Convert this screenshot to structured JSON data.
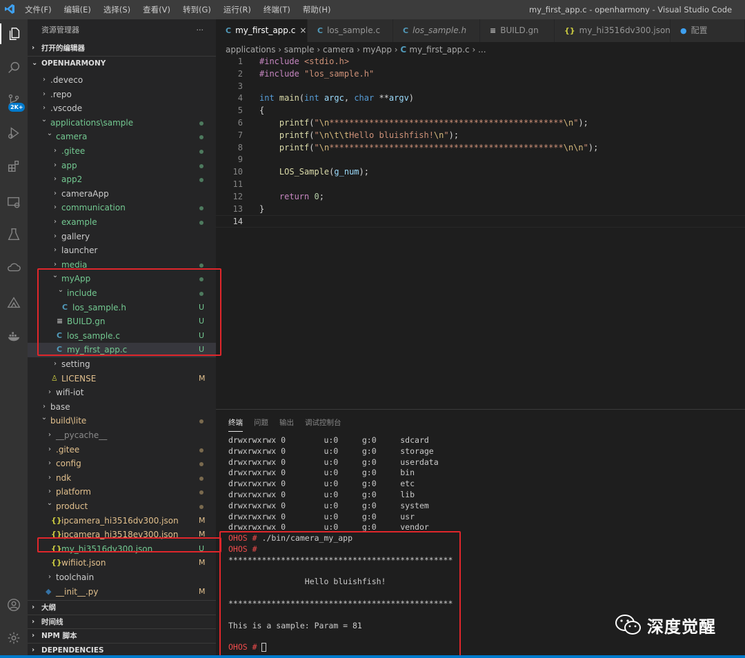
{
  "titlebar": {
    "menu": [
      "文件(F)",
      "编辑(E)",
      "选择(S)",
      "查看(V)",
      "转到(G)",
      "运行(R)",
      "终端(T)",
      "帮助(H)"
    ],
    "window_title": "my_first_app.c - openharmony - Visual Studio Code"
  },
  "activity": {
    "badge": "2K+"
  },
  "sidebar": {
    "header": "资源管理器",
    "more": "···",
    "open_editors": "打开的编辑器",
    "workspace": "OPENHARMONY",
    "items": [
      {
        "label": ".deveco",
        "depth": 0,
        "type": "folder",
        "status": ""
      },
      {
        "label": ".repo",
        "depth": 0,
        "type": "folder",
        "status": ""
      },
      {
        "label": ".vscode",
        "depth": 0,
        "type": "folder",
        "status": ""
      },
      {
        "label": "applications\\sample",
        "depth": 0,
        "type": "folder-open",
        "status": "dot",
        "color": "#73c991"
      },
      {
        "label": "camera",
        "depth": 1,
        "type": "folder-open",
        "status": "dot",
        "color": "#73c991"
      },
      {
        "label": ".gitee",
        "depth": 2,
        "type": "folder",
        "status": "dot",
        "color": "#73c991"
      },
      {
        "label": "app",
        "depth": 2,
        "type": "folder",
        "status": "dot",
        "color": "#73c991"
      },
      {
        "label": "app2",
        "depth": 2,
        "type": "folder",
        "status": "dot",
        "color": "#73c991"
      },
      {
        "label": "cameraApp",
        "depth": 2,
        "type": "folder",
        "status": ""
      },
      {
        "label": "communication",
        "depth": 2,
        "type": "folder",
        "status": "dot",
        "color": "#73c991"
      },
      {
        "label": "example",
        "depth": 2,
        "type": "folder",
        "status": "dot",
        "color": "#73c991"
      },
      {
        "label": "gallery",
        "depth": 2,
        "type": "folder",
        "status": ""
      },
      {
        "label": "launcher",
        "depth": 2,
        "type": "folder",
        "status": ""
      },
      {
        "label": "media",
        "depth": 2,
        "type": "folder",
        "status": "dot",
        "color": "#73c991"
      },
      {
        "label": "myApp",
        "depth": 2,
        "type": "folder-open",
        "status": "dot",
        "color": "#73c991"
      },
      {
        "label": "include",
        "depth": 3,
        "type": "folder-open",
        "status": "dot",
        "color": "#73c991"
      },
      {
        "label": "los_sample.h",
        "depth": 4,
        "type": "c",
        "status": "U",
        "color": "#73c991"
      },
      {
        "label": "BUILD.gn",
        "depth": 3,
        "type": "gn",
        "status": "U",
        "color": "#73c991"
      },
      {
        "label": "los_sample.c",
        "depth": 3,
        "type": "c",
        "status": "U",
        "color": "#73c991"
      },
      {
        "label": "my_first_app.c",
        "depth": 3,
        "type": "c",
        "status": "U",
        "color": "#73c991",
        "selected": true
      },
      {
        "label": "setting",
        "depth": 2,
        "type": "folder",
        "status": ""
      },
      {
        "label": "LICENSE",
        "depth": 2,
        "type": "license",
        "status": "M",
        "color": "#e2c08d"
      },
      {
        "label": "wifi-iot",
        "depth": 1,
        "type": "folder",
        "status": ""
      },
      {
        "label": "base",
        "depth": 0,
        "type": "folder",
        "status": ""
      },
      {
        "label": "build\\lite",
        "depth": 0,
        "type": "folder-open",
        "status": "dot",
        "color": "#e2c08d"
      },
      {
        "label": "__pycache__",
        "depth": 1,
        "type": "folder",
        "status": "",
        "color": "#8c8c8c"
      },
      {
        "label": ".gitee",
        "depth": 1,
        "type": "folder",
        "status": "dot",
        "color": "#e2c08d"
      },
      {
        "label": "config",
        "depth": 1,
        "type": "folder",
        "status": "dot",
        "color": "#e2c08d"
      },
      {
        "label": "ndk",
        "depth": 1,
        "type": "folder",
        "status": "dot",
        "color": "#e2c08d"
      },
      {
        "label": "platform",
        "depth": 1,
        "type": "folder",
        "status": "dot",
        "color": "#e2c08d"
      },
      {
        "label": "product",
        "depth": 1,
        "type": "folder-open",
        "status": "dot",
        "color": "#e2c08d"
      },
      {
        "label": "ipcamera_hi3516dv300.json",
        "depth": 2,
        "type": "json",
        "status": "M",
        "color": "#e2c08d"
      },
      {
        "label": "ipcamera_hi3518ev300.json",
        "depth": 2,
        "type": "json",
        "status": "M",
        "color": "#e2c08d"
      },
      {
        "label": "my_hi3516dv300.json",
        "depth": 2,
        "type": "json",
        "status": "U",
        "color": "#73c991"
      },
      {
        "label": "wifiiot.json",
        "depth": 2,
        "type": "json",
        "status": "M",
        "color": "#e2c08d"
      },
      {
        "label": "toolchain",
        "depth": 1,
        "type": "folder",
        "status": ""
      },
      {
        "label": "__init__.py",
        "depth": 1,
        "type": "py",
        "status": "M",
        "color": "#e2c08d"
      }
    ],
    "sections": [
      "大纲",
      "时间线",
      "NPM 脚本",
      "DEPENDENCIES"
    ]
  },
  "tabs": [
    {
      "label": "my_first_app.c",
      "icon": "C",
      "active": true,
      "close": "×"
    },
    {
      "label": "los_sample.c",
      "icon": "C"
    },
    {
      "label": "los_sample.h",
      "icon": "C",
      "italic": true
    },
    {
      "label": "BUILD.gn",
      "icon": "≡"
    },
    {
      "label": "my_hi3516dv300.json",
      "icon": "{}"
    },
    {
      "label": "配置",
      "icon": "●"
    }
  ],
  "breadcrumb": {
    "parts": [
      "applications",
      "sample",
      "camera",
      "myApp"
    ],
    "file": "my_first_app.c",
    "tail": "..."
  },
  "code": [
    {
      "n": "1",
      "t": [
        [
          "#include ",
          "#c586c0"
        ],
        [
          "<stdio.h>",
          "#ce9178"
        ]
      ]
    },
    {
      "n": "2",
      "t": [
        [
          "#include ",
          "#c586c0"
        ],
        [
          "\"los_sample.h\"",
          "#ce9178"
        ]
      ]
    },
    {
      "n": "3",
      "t": []
    },
    {
      "n": "4",
      "t": [
        [
          "int ",
          "#569cd6"
        ],
        [
          "main",
          "#dcdcaa"
        ],
        [
          "(",
          "#d4d4d4"
        ],
        [
          "int ",
          "#569cd6"
        ],
        [
          "argc",
          "#9cdcfe"
        ],
        [
          ", ",
          "#d4d4d4"
        ],
        [
          "char ",
          "#569cd6"
        ],
        [
          "**",
          "#d4d4d4"
        ],
        [
          "argv",
          "#9cdcfe"
        ],
        [
          ")",
          "#d4d4d4"
        ]
      ]
    },
    {
      "n": "5",
      "t": [
        [
          "{",
          "#d4d4d4"
        ]
      ]
    },
    {
      "n": "6",
      "t": [
        [
          "    ",
          ""
        ],
        [
          "printf",
          "#dcdcaa"
        ],
        [
          "(",
          "#d4d4d4"
        ],
        [
          "\"",
          "#ce9178"
        ],
        [
          "\\n",
          "#d7ba7d"
        ],
        [
          "***********************************************",
          "#ce9178"
        ],
        [
          "\\n",
          "#d7ba7d"
        ],
        [
          "\"",
          "#ce9178"
        ],
        [
          ");",
          "#d4d4d4"
        ]
      ]
    },
    {
      "n": "7",
      "t": [
        [
          "    ",
          ""
        ],
        [
          "printf",
          "#dcdcaa"
        ],
        [
          "(",
          "#d4d4d4"
        ],
        [
          "\"",
          "#ce9178"
        ],
        [
          "\\n\\t\\t",
          "#d7ba7d"
        ],
        [
          "Hello bluishfish!",
          "#ce9178"
        ],
        [
          "\\n",
          "#d7ba7d"
        ],
        [
          "\"",
          "#ce9178"
        ],
        [
          ");",
          "#d4d4d4"
        ]
      ]
    },
    {
      "n": "8",
      "t": [
        [
          "    ",
          ""
        ],
        [
          "printf",
          "#dcdcaa"
        ],
        [
          "(",
          "#d4d4d4"
        ],
        [
          "\"",
          "#ce9178"
        ],
        [
          "\\n",
          "#d7ba7d"
        ],
        [
          "***********************************************",
          "#ce9178"
        ],
        [
          "\\n\\n",
          "#d7ba7d"
        ],
        [
          "\"",
          "#ce9178"
        ],
        [
          ");",
          "#d4d4d4"
        ]
      ]
    },
    {
      "n": "9",
      "t": []
    },
    {
      "n": "10",
      "t": [
        [
          "    ",
          ""
        ],
        [
          "LOS_Sample",
          "#dcdcaa"
        ],
        [
          "(",
          "#d4d4d4"
        ],
        [
          "g_num",
          "#9cdcfe"
        ],
        [
          ");",
          "#d4d4d4"
        ]
      ]
    },
    {
      "n": "11",
      "t": []
    },
    {
      "n": "12",
      "t": [
        [
          "    ",
          ""
        ],
        [
          "return ",
          "#c586c0"
        ],
        [
          "0",
          "#b5cea8"
        ],
        [
          ";",
          "#d4d4d4"
        ]
      ]
    },
    {
      "n": "13",
      "t": [
        [
          "}",
          "#d4d4d4"
        ]
      ]
    },
    {
      "n": "14",
      "t": [],
      "current": true
    }
  ],
  "panel": {
    "tabs": [
      "终端",
      "问题",
      "输出",
      "调试控制台"
    ],
    "active": 0
  },
  "terminal": [
    {
      "t": "drwxrwxrwx 0        u:0     g:0     sdcard"
    },
    {
      "t": "drwxrwxrwx 0        u:0     g:0     storage"
    },
    {
      "t": "drwxrwxrwx 0        u:0     g:0     userdata"
    },
    {
      "t": "drwxrwxrwx 0        u:0     g:0     bin"
    },
    {
      "t": "drwxrwxrwx 0        u:0     g:0     etc"
    },
    {
      "t": "drwxrwxrwx 0        u:0     g:0     lib"
    },
    {
      "t": "drwxrwxrwx 0        u:0     g:0     system"
    },
    {
      "t": "drwxrwxrwx 0        u:0     g:0     usr"
    },
    {
      "t": "drwxrwxrwx 0        u:0     g:0     vendor"
    },
    {
      "p": "OHOS # ",
      "t": "./bin/camera_my_app"
    },
    {
      "p": "OHOS # ",
      "t": ""
    },
    {
      "t": "***********************************************"
    },
    {
      "t": ""
    },
    {
      "t": "                Hello bluishfish!"
    },
    {
      "t": ""
    },
    {
      "t": "***********************************************"
    },
    {
      "t": ""
    },
    {
      "t": "This is a sample: Param = 81"
    },
    {
      "t": ""
    },
    {
      "p": "OHOS # ",
      "t": "",
      "cursor": true
    }
  ],
  "watermark": {
    "text": "深度觉醒"
  }
}
